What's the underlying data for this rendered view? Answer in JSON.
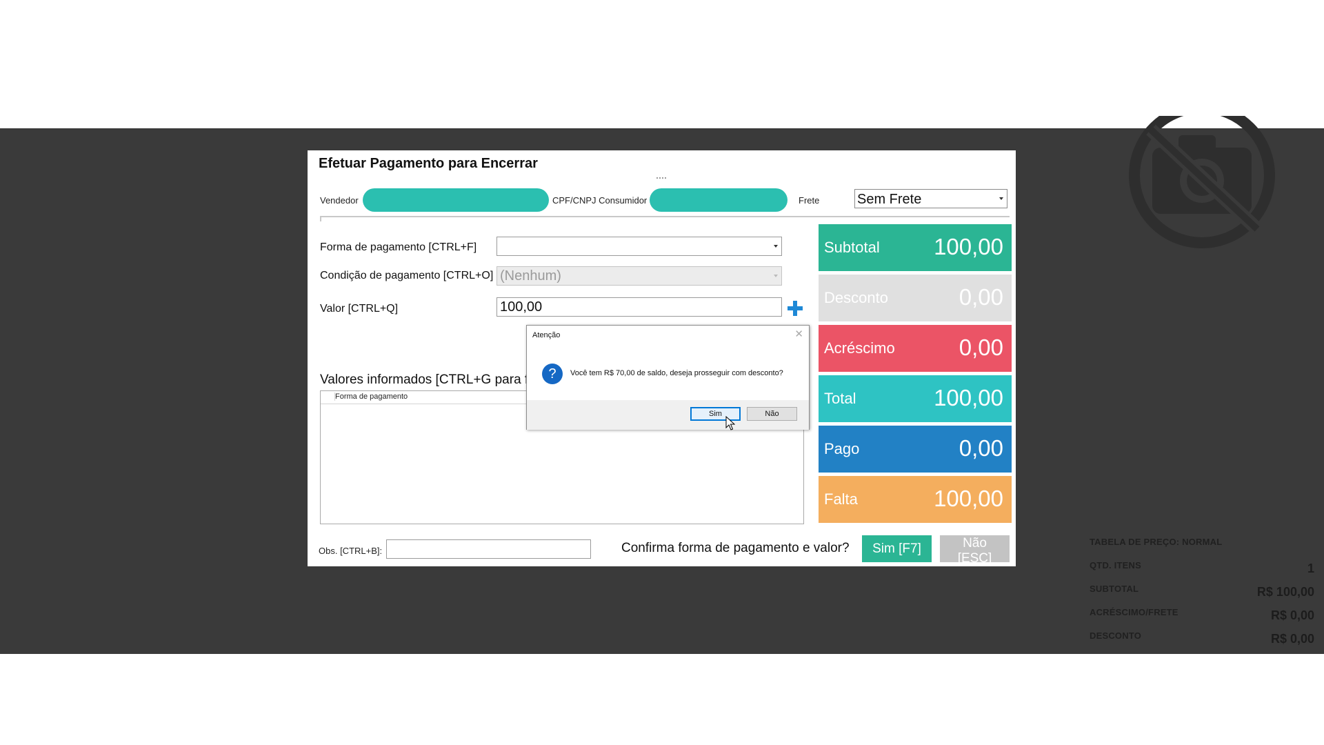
{
  "payment_dialog": {
    "title": "Efetuar Pagamento para Encerrar",
    "vendedor_label": "Vendedor",
    "cpf_label": "CPF/CNPJ Consumidor",
    "frete_label": "Frete",
    "frete_value": "Sem Frete",
    "forma_label": "Forma de pagamento [CTRL+F]",
    "forma_value": "",
    "condicao_label": "Condição de pagamento [CTRL+O]",
    "condicao_value": "(Nenhum)",
    "valor_label": "Valor [CTRL+Q]",
    "valor_value": "100,00",
    "valores_title": "Valores informados [CTRL+G para focar]",
    "table_header": "Forma de pagamento",
    "obs_label": "Obs. [CTRL+B]:",
    "obs_value": "",
    "confirm_text": "Confirma forma de pagamento e valor?",
    "sim_button": "Sim [F7]",
    "nao_button": "Não [ESC]"
  },
  "totals": [
    {
      "label": "Subtotal",
      "value": "100,00",
      "color": "#2bb594"
    },
    {
      "label": "Desconto",
      "value": "0,00",
      "color": "#e0e0e0"
    },
    {
      "label": "Acréscimo",
      "value": "0,00",
      "color": "#eb5466"
    },
    {
      "label": "Total",
      "value": "100,00",
      "color": "#2ec3c3"
    },
    {
      "label": "Pago",
      "value": "0,00",
      "color": "#2281c5"
    },
    {
      "label": "Falta",
      "value": "100,00",
      "color": "#f4ae5e"
    }
  ],
  "message_box": {
    "title": "Atenção",
    "text": "Você tem R$ 70,00 de saldo, deseja prosseguir com desconto?",
    "icon": "question-icon",
    "yes": "Sim",
    "no": "Não"
  },
  "summary": {
    "tabela": "TABELA DE PREÇO: NORMAL",
    "qtd_label": "QTD. ITENS",
    "qtd_value": "1",
    "subtotal_label": "SUBTOTAL",
    "subtotal_value": "R$ 100,00",
    "acrescimo_label": "ACRÉSCIMO/FRETE",
    "acrescimo_value": "R$ 0,00",
    "desconto_label": "DESCONTO",
    "desconto_value": "R$ 0,00"
  },
  "background_icon": "no-camera-icon"
}
